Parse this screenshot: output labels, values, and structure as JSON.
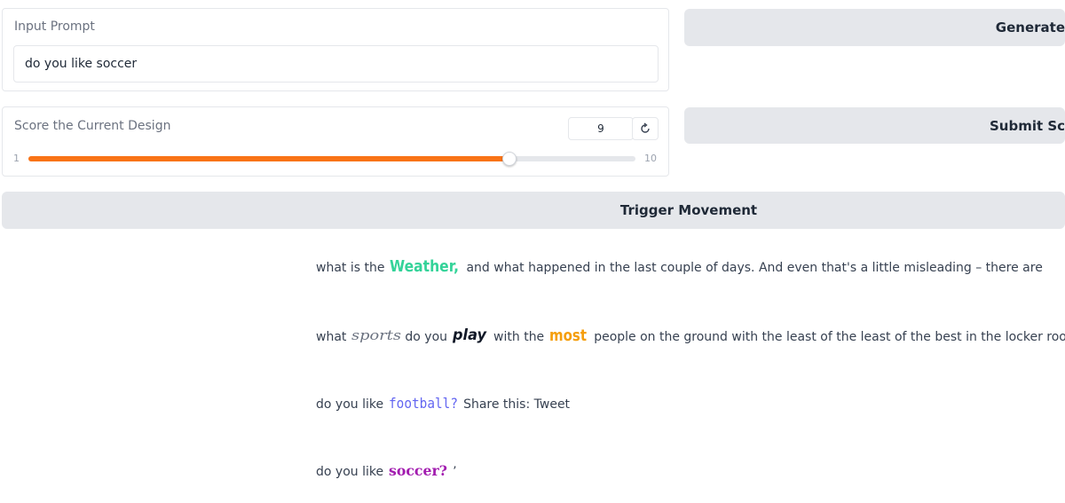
{
  "prompt": {
    "label": "Input Prompt",
    "value": "do you like soccer"
  },
  "generate_button": "Generate",
  "score": {
    "label": "Score the Current Design",
    "value": "9",
    "min_label": "1",
    "max_label": "10",
    "min": 1,
    "max": 10,
    "current": 9
  },
  "submit_button": "Submit Score",
  "trigger_button": "Trigger Movement",
  "accent_color": "#f97316",
  "lines": [
    {
      "before": "what is the",
      "stylized_1": "Weather",
      "after": "and what happened in the last couple of days. And even that's a little misleading – there are"
    },
    {
      "before": "what",
      "stylized_1": "sports",
      "middle_1": "do you",
      "stylized_2": "play",
      "middle_2": "with the",
      "stylized_3": "most",
      "after": "people on the ground with the least of the least of the best in the locker room"
    },
    {
      "before": "do you like",
      "stylized_1": "football?",
      "after": "Share this: Tweet"
    },
    {
      "before": "do you like",
      "stylized_1": "soccer?",
      "after": "’"
    }
  ]
}
